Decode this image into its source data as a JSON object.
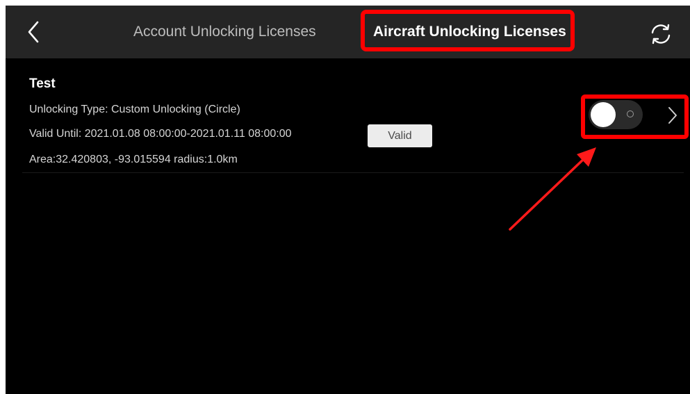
{
  "header": {
    "tabs": [
      {
        "label": "Account Unlocking Licenses",
        "active": false
      },
      {
        "label": "Aircraft Unlocking Licenses",
        "active": true
      }
    ],
    "back_icon": "chevron-left-icon",
    "refresh_icon": "refresh-icon"
  },
  "license": {
    "name": "Test",
    "type_text": "Unlocking Type:  Custom Unlocking (Circle)",
    "valid_text": "Valid Until:  2021.01.08 08:00:00-2021.01.11 08:00:00",
    "status": "Valid",
    "area_text": "Area:32.420803, -93.015594  radius:1.0km",
    "enabled": true
  },
  "colors": {
    "background": "#000000",
    "topbar": "#252525",
    "annotation": "#ff0000",
    "badge_bg": "#ececec"
  }
}
